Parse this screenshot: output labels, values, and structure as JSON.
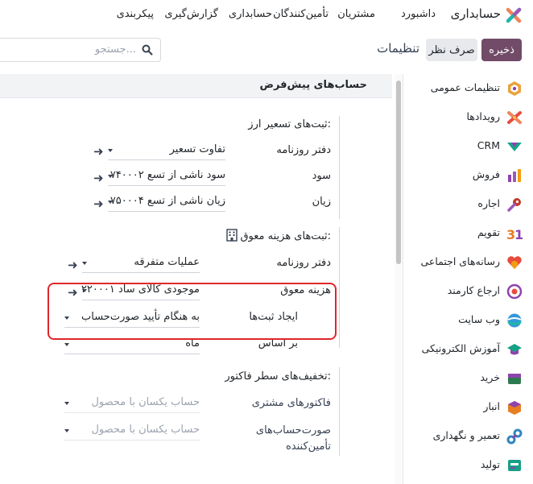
{
  "app": {
    "name": "حسابداری",
    "menu": [
      "داشبورد",
      "مشتریان",
      "تأمین‌کنندگان",
      "حسابداری",
      "گزارش‌گیری",
      "پیکربندی"
    ]
  },
  "control": {
    "save_label": "ذخیره",
    "discard_label": "صرف نظر",
    "page_title": "تنظیمات",
    "search_placeholder": "جستجو..."
  },
  "section": {
    "title": "حساب‌های پیش‌فرض"
  },
  "exchange": {
    "title": "ثبت‌های تسعیر ارز:",
    "journal_label": "دفتر روزنامه",
    "journal_value": "تفاوت تسعیر",
    "gain_label": "سود",
    "gain_value": "۷۴۰۰۰۲ سود ناشی از تسع",
    "loss_label": "زیان",
    "loss_value": "۷۵۰۰۰۴ زیان ناشی از تسع"
  },
  "deferred": {
    "title": "ثبت‌های هزینه معوق:",
    "journal_label": "دفتر روزنامه",
    "journal_value": "عملیات متفرقه",
    "expense_label": "هزینه معوق",
    "expense_value": "۲۲۰۰۰۱ موجودی کالای ساد",
    "generate_label": "ایجاد ثبت‌ها",
    "generate_value": "به هنگام تأیید صورت‌حساب",
    "based_label": "بر اساس",
    "based_value": "ماه"
  },
  "discount": {
    "title": "تخفیف‌های سطر فاکتور:",
    "customer_label": "فاکتورهای مشتری",
    "customer_placeholder": "حساب یکسان با محصول",
    "vendor_label_1": "صورت‌حساب‌های",
    "vendor_label_2": "تأمین‌کننده",
    "vendor_placeholder": "حساب یکسان با محصول"
  },
  "sidebar": {
    "items": [
      {
        "label": "تنظیمات عمومی",
        "icon": "general-settings-icon"
      },
      {
        "label": "رویدادها",
        "icon": "events-icon"
      },
      {
        "label": "CRM",
        "icon": "crm-icon"
      },
      {
        "label": "فروش",
        "icon": "sales-icon"
      },
      {
        "label": "اجاره",
        "icon": "rental-icon"
      },
      {
        "label": "تقویم",
        "icon": "calendar-icon"
      },
      {
        "label": "رسانه‌های اجتماعی",
        "icon": "social-media-icon"
      },
      {
        "label": "ارجاع کارمند",
        "icon": "employee-referral-icon"
      },
      {
        "label": "وب سایت",
        "icon": "website-icon"
      },
      {
        "label": "آموزش الکترونیکی",
        "icon": "elearning-icon"
      },
      {
        "label": "خرید",
        "icon": "purchase-icon"
      },
      {
        "label": "انبار",
        "icon": "inventory-icon"
      },
      {
        "label": "تعمیر و نگهداری",
        "icon": "maintenance-icon"
      },
      {
        "label": "تولید",
        "icon": "manufacturing-icon"
      }
    ]
  },
  "colors": {
    "brand": "#714b67",
    "highlight": "#e0262c",
    "section_bg": "#f2f3f5"
  }
}
